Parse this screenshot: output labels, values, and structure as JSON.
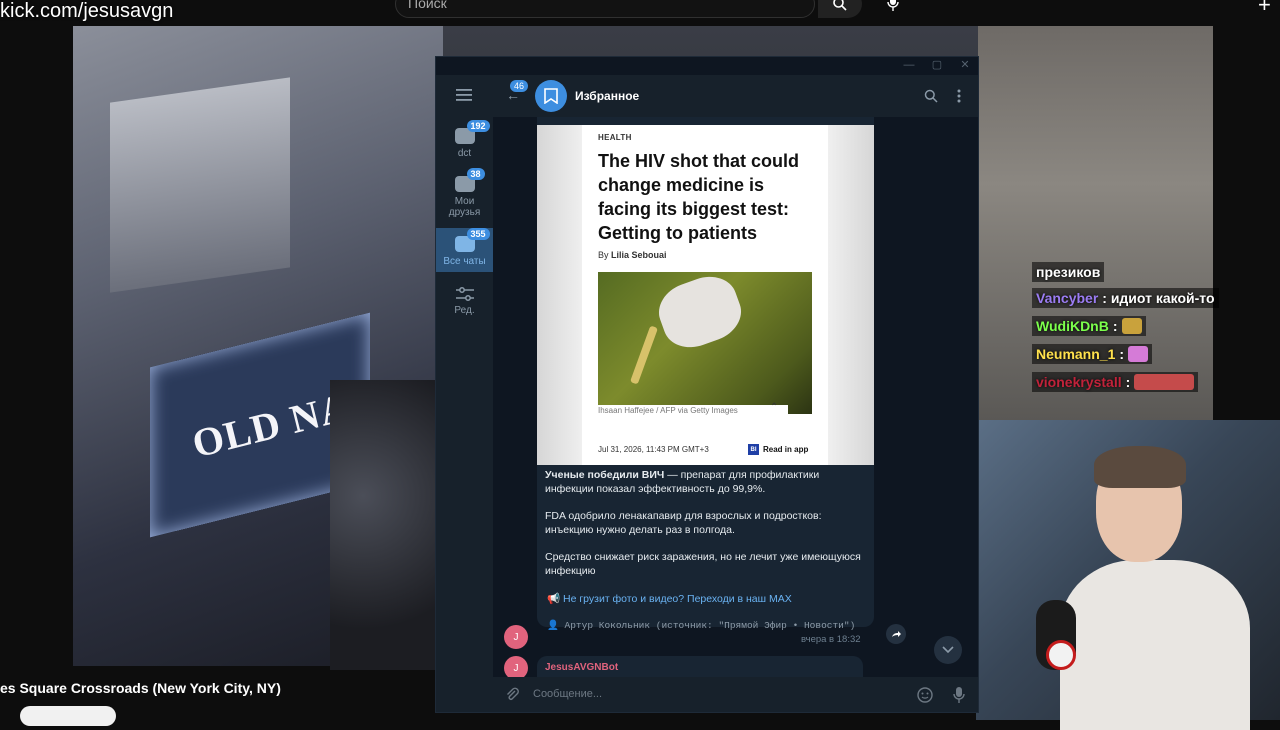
{
  "overlay": {
    "url_label": "kick.com/jesusavgn",
    "search_placeholder": "Поиск",
    "stream_title": "es Square Crossroads (New York City, NY)",
    "billboard_text": "OLD NAVY"
  },
  "chat": {
    "header": "презиков",
    "messages": [
      {
        "user": "Vancyber",
        "color": "#9b7cf3",
        "text": ": идиот какой-то"
      },
      {
        "user": "WudiKDnB",
        "color": "#7cff4c",
        "text": " :",
        "emote": "#c9a23c"
      },
      {
        "user": "Neumann_1",
        "color": "#ffe14c",
        "text": " :",
        "emote": "#d57bd7"
      },
      {
        "user": "vionekrystall",
        "color": "#c1223a",
        "text": " :",
        "emote": "#c54b4b"
      }
    ]
  },
  "telegram": {
    "sidebar": [
      {
        "label": "dct",
        "badge": "192",
        "active": false
      },
      {
        "label": "Мои друзья",
        "badge": "38",
        "active": false
      },
      {
        "label": "Все чаты",
        "badge": "355",
        "active": true
      },
      {
        "label": "Ред.",
        "badge": "",
        "active": false
      }
    ],
    "header": {
      "back_badge": "46",
      "title": "Избранное"
    },
    "article": {
      "kicker": "HEALTH",
      "headline": "The HIV shot that could change medicine is facing its biggest test: Getting to patients",
      "byline_prefix": "By",
      "byline_author": "Lilia Sebouai",
      "caption": "Ihsaan Haffejee / AFP via Getty Images",
      "date": "Jul 31, 2026, 11:43 PM GMT+3",
      "read_in_app": "Read in app",
      "bi_logo": "BI"
    },
    "message": {
      "bold_lead": "Ученые победили ВИЧ",
      "p1_rest": " — препарат для профилактики инфекции показал эффективность до 99,9%.",
      "p2": "FDA одобрило ленакапавир для взрослых и подростков: инъекцию нужно делать раз в полгода.",
      "p3": "Средство снижает риск заражения, но не лечит уже имеющуюся инфекцию",
      "link": "Не грузит фото и видео? Переходи в наш MAX",
      "source": "Артур Кокольник (источник: \"Прямой Эфир • Новости\")",
      "time": "вчера в 18:32",
      "sender_initial": "J"
    },
    "next_message": {
      "sender": "JesusAVGNBot",
      "initial": "J"
    },
    "input_placeholder": "Сообщение..."
  }
}
